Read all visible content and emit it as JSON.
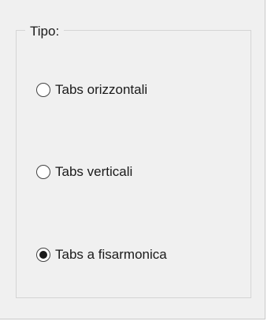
{
  "group": {
    "title": "Tipo:"
  },
  "options": [
    {
      "label": "Tabs orizzontali",
      "checked": false
    },
    {
      "label": "Tabs verticali",
      "checked": false
    },
    {
      "label": "Tabs a fisarmonica",
      "checked": true
    }
  ]
}
